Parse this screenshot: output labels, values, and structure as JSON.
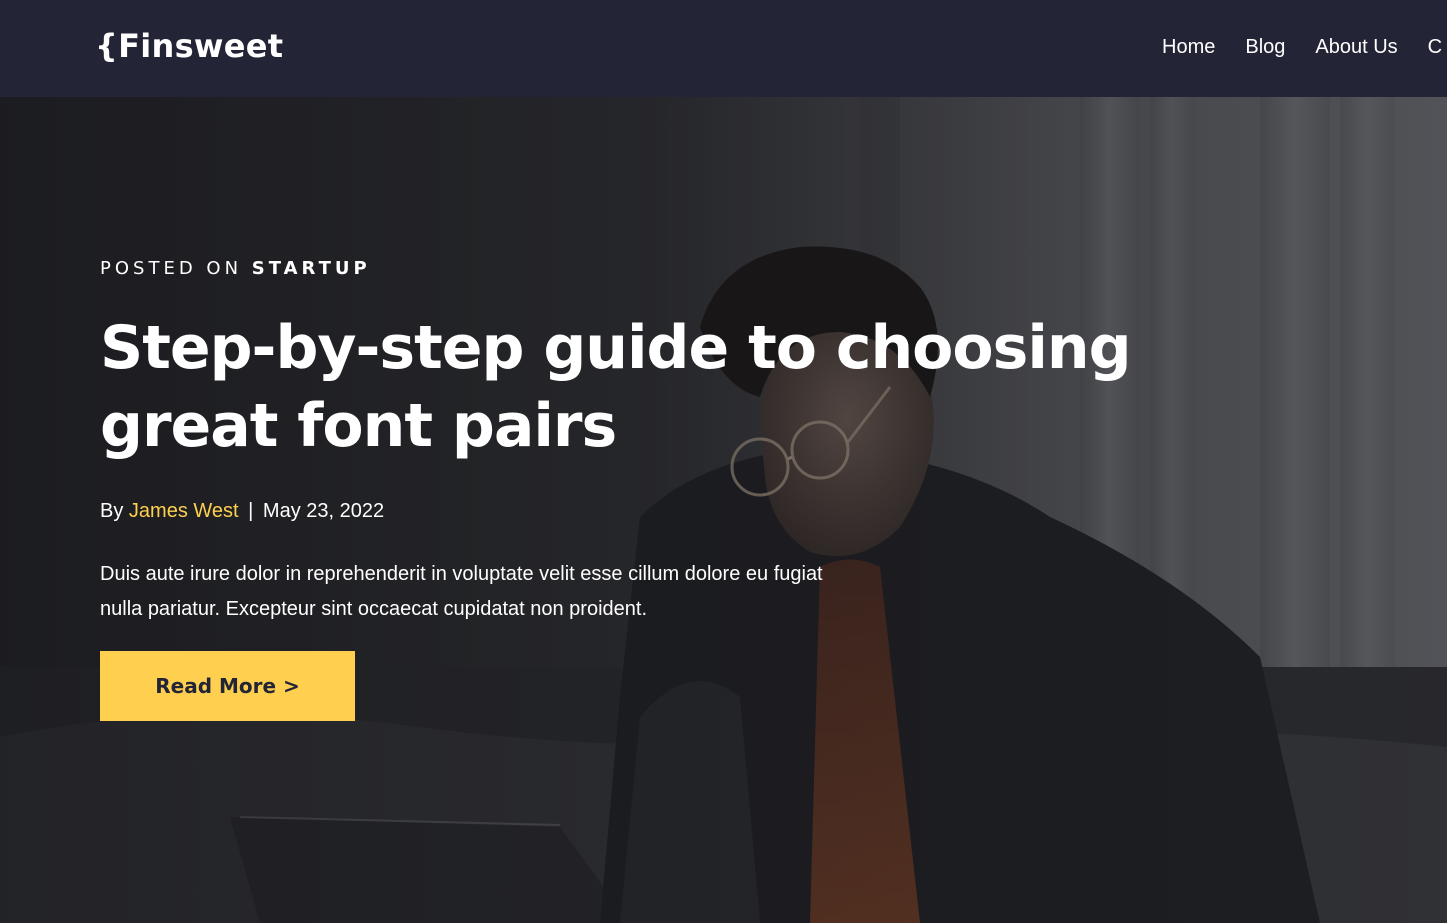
{
  "header": {
    "logo": "{Finsweet",
    "nav": [
      {
        "label": "Home"
      },
      {
        "label": "Blog"
      },
      {
        "label": "About Us"
      },
      {
        "label": "C"
      }
    ]
  },
  "hero": {
    "category_prefix": "POSTED ON ",
    "category": "STARTUP",
    "title": "Step-by-step guide to choosing great font pairs",
    "by_label": "By ",
    "author": "James West",
    "separator": "|",
    "date": "May 23, 2022",
    "excerpt": "Duis aute irure dolor in reprehenderit in voluptate velit esse cillum dolore eu fugiat nulla pariatur. Excepteur sint occaecat cupidatat non proident.",
    "cta_label": "Read More >"
  },
  "colors": {
    "header_bg": "#232536",
    "accent": "#ffd050",
    "text": "#ffffff"
  }
}
